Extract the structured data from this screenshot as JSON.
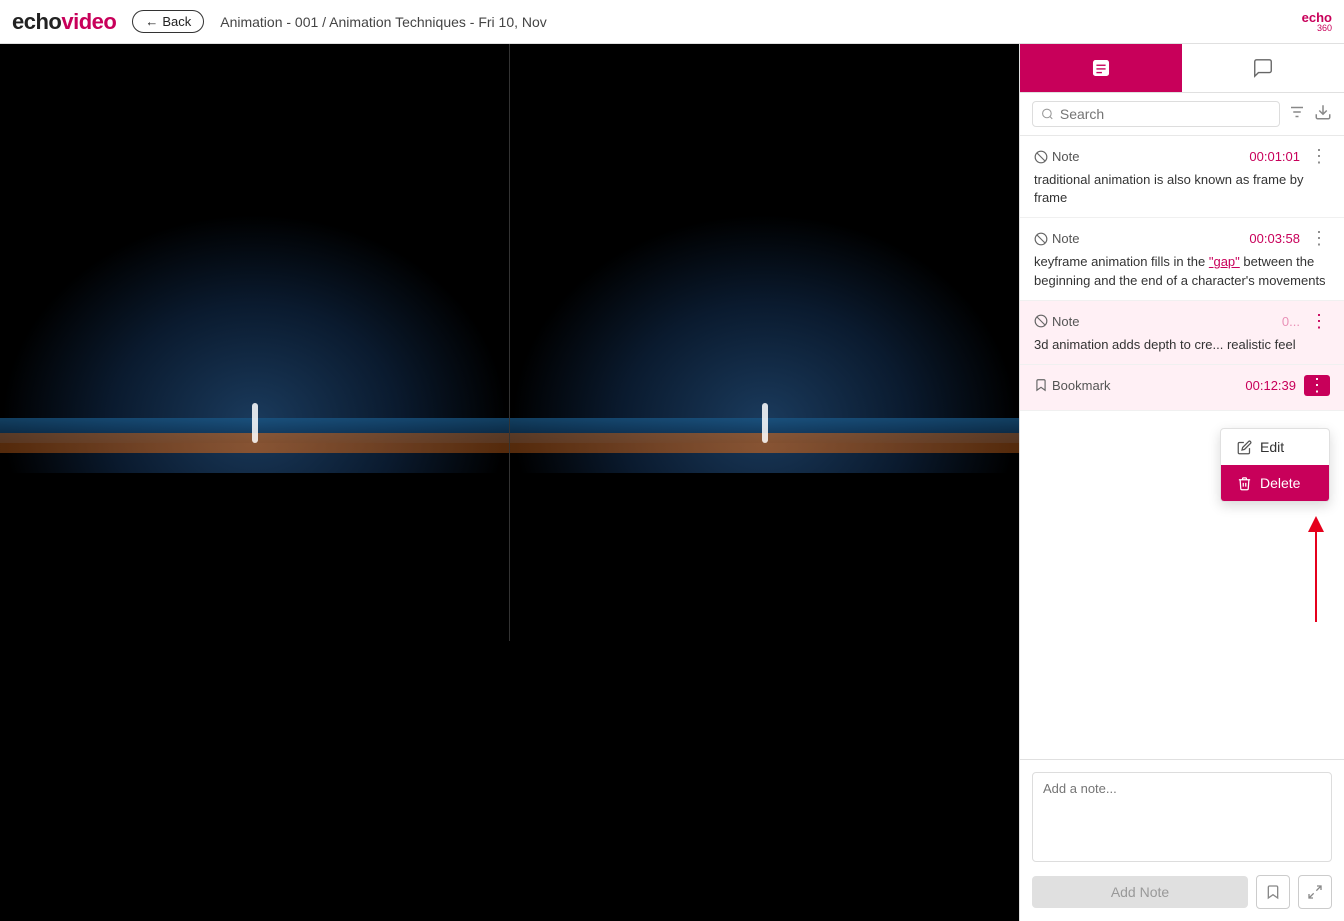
{
  "header": {
    "logo_echo": "echo",
    "logo_video": "video",
    "back_label": "Back",
    "breadcrumb": "Animation - 001 / Animation Techniques - Fri 10, Nov",
    "echo360_line1": "echo",
    "echo360_line2": "360"
  },
  "sidebar": {
    "tabs": [
      {
        "id": "notes",
        "label": "Notes tab",
        "active": true
      },
      {
        "id": "chat",
        "label": "Chat tab",
        "active": false
      }
    ],
    "search_placeholder": "Search",
    "notes": [
      {
        "type": "Note",
        "time": "00:01:01",
        "text": "traditional animation is also known as frame by frame"
      },
      {
        "type": "Note",
        "time": "00:03:58",
        "text": "keyframe animation fills in the \"gap\" between the beginning and the end of a character's movements"
      },
      {
        "type": "Note",
        "time": "0(truncated)",
        "text": "3d animation adds depth to cre... realistic feel"
      },
      {
        "type": "Bookmark",
        "time": "00:12:39",
        "text": ""
      }
    ],
    "context_menu": {
      "edit_label": "Edit",
      "delete_label": "Delete"
    },
    "add_note_placeholder": "Add a note...",
    "add_note_button": "Add Note"
  }
}
